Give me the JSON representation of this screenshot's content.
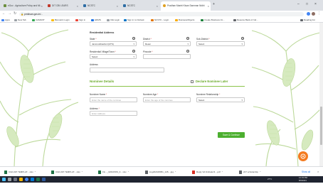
{
  "browser": {
    "tabs": [
      {
        "title": "eGov - Agriculture Policy and Mi...",
        "active": false
      },
      {
        "title": "DIT CBI LEARS",
        "active": false
      },
      {
        "title": "NCSTC",
        "active": false
      },
      {
        "title": "NCSTC",
        "active": false
      },
      {
        "title": "Pradhan Mantri Kisan Samman Nidhi",
        "active": true
      }
    ],
    "url": "pmkisan.gov.in/...",
    "bookmarks": [
      "Apps",
      "New Tab",
      "CAMANT",
      "Biometric Login",
      "Sign in",
      "HRMS",
      "ICE Login",
      "Sign in to Outlook",
      "NCSTC - Login",
      "BusinessObjects",
      "Create Business Int...",
      "Reserve Bank of Ind..."
    ],
    "reading_list": "Reading list"
  },
  "form": {
    "residential_address_title": "Residential Address",
    "state_label": "State",
    "state_value": "Jammu&Kashmir(UTS)",
    "district_label": "District",
    "district_value": "Reasi",
    "sub_district_label": "Sub-District",
    "sub_district_value": "Select",
    "village_label": "Residential Village/Town",
    "village_value": "Select",
    "pincode_label": "Pincode",
    "address_label": "Address",
    "nominee_details_title": "Nominee Details",
    "declare_nominee_label": "Declare Nominee Later",
    "nominee_name_label": "Nominee Name",
    "nominee_name_placeholder": "Enter the name of the nominee",
    "nominee_age_label": "Nominee Age",
    "nominee_age_placeholder": "Enter the age of the nominee",
    "nominee_relationship_label": "Nominee Relationship",
    "nominee_relationship_value": "Select",
    "nominee_address_label": "Address",
    "nominee_address_placeholder": "Enter Address",
    "save_button": "Save & Continue",
    "required_mark": "*",
    "info_glyph": "i"
  },
  "downloads": {
    "items": [
      "CGD API TEMPLAT....xlsx",
      "CGD API TEMPLAT....xlsx",
      "Fin..._0262156S_F....xlsx",
      "img202108051_145....jpg",
      "Reply SA Sinhala R....pdf",
      "227 scholarship"
    ],
    "show_all": "Show all"
  },
  "taskbar": {
    "weather": "27°C",
    "time": "12:33 PM",
    "date": "8/6/2021"
  },
  "colors": {
    "accent_green": "#6aaa2a",
    "button_green": "#4caf2f",
    "fab_orange": "#f47b20"
  }
}
